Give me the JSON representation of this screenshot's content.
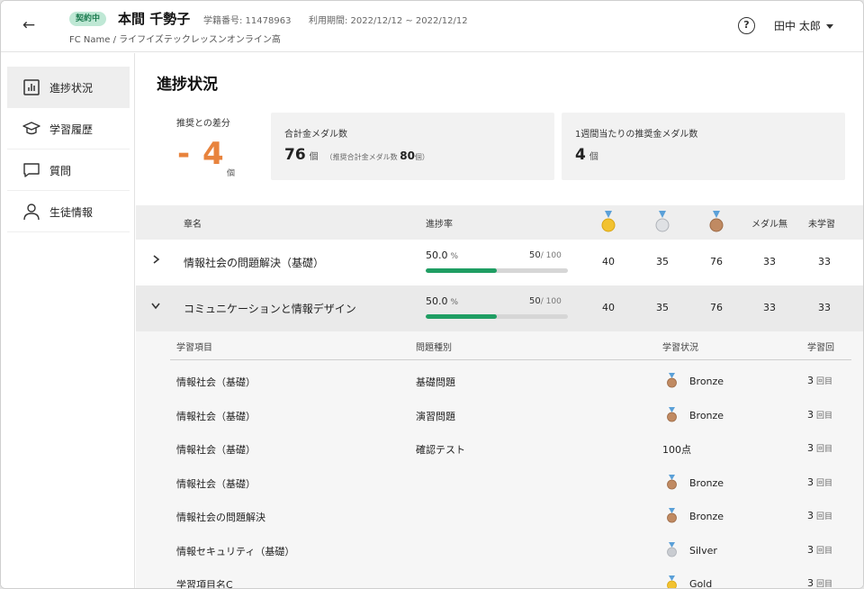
{
  "header": {
    "back_icon": "back-arrow-icon",
    "contract_badge": "契約中",
    "student_name": "本間 千勢子",
    "student_id": "学籍番号: 11478963",
    "period": "利用期間: 2022/12/12 ~ 2022/12/12",
    "breadcrumb": "FC Name / ライフイズテックレッスンオンライン高",
    "help_icon": "help-icon",
    "user_name": "田中 太郎"
  },
  "sidebar": {
    "items": [
      {
        "label": "進捗状況",
        "icon": "chart-icon",
        "active": true
      },
      {
        "label": "学習履歴",
        "icon": "graduation-cap-icon",
        "active": false
      },
      {
        "label": "質問",
        "icon": "chat-bubble-icon",
        "active": false
      },
      {
        "label": "生徒情報",
        "icon": "person-icon",
        "active": false
      }
    ]
  },
  "main": {
    "title": "進捗状況",
    "recommend_diff": {
      "label": "推奨との差分",
      "value": "- 4",
      "unit": "個"
    },
    "total_medals": {
      "label": "合計金メダル数",
      "value": "76",
      "unit": "個",
      "sub_label": "（推奨合計金メダル数",
      "sub_value": "80",
      "sub_unit": "個）"
    },
    "weekly_medals": {
      "label": "1週間当たりの推奨金メダル数",
      "value": "4",
      "unit": "個"
    }
  },
  "table": {
    "headers": {
      "chapter": "章名",
      "progress": "進捗率",
      "no_medal": "メダル無",
      "not_studied": "未学習"
    },
    "medal_colors": {
      "gold": "#f2c230",
      "silver": "#c9ccd1",
      "bronze": "#c08a62",
      "ribbon": "#5aa0d8"
    },
    "rows": [
      {
        "name": "情報社会の問題解決（基礎）",
        "percent": "50.0",
        "percent_unit": "%",
        "done": "50",
        "total": "/ 100",
        "progress": 0.5,
        "gold": "40",
        "silver": "35",
        "bronze": "76",
        "no_medal": "33",
        "not_studied": "33",
        "expanded": false
      },
      {
        "name": "コミュニケーションと情報デザイン",
        "percent": "50.0",
        "percent_unit": "%",
        "done": "50",
        "total": "/ 100",
        "progress": 0.5,
        "gold": "40",
        "silver": "35",
        "bronze": "76",
        "no_medal": "33",
        "not_studied": "33",
        "expanded": true
      }
    ]
  },
  "detail": {
    "headers": {
      "item": "学習項目",
      "type": "問題種別",
      "status": "学習状況",
      "count": "学習回"
    },
    "count_unit": "回目",
    "rows": [
      {
        "item": "情報社会（基礎）",
        "type": "基礎問題",
        "medal": "bronze",
        "status": "Bronze",
        "count": "3"
      },
      {
        "item": "情報社会（基礎）",
        "type": "演習問題",
        "medal": "bronze",
        "status": "Bronze",
        "count": "3"
      },
      {
        "item": "情報社会（基礎）",
        "type": "確認テスト",
        "medal": "",
        "status": "100点",
        "count": "3"
      },
      {
        "item": "情報社会（基礎）",
        "type": "",
        "medal": "bronze",
        "status": "Bronze",
        "count": "3"
      },
      {
        "item": "情報社会の問題解決",
        "type": "",
        "medal": "bronze",
        "status": "Bronze",
        "count": "3"
      },
      {
        "item": "情報セキュリティ（基礎）",
        "type": "",
        "medal": "silver",
        "status": "Silver",
        "count": "3"
      },
      {
        "item": "学習項目名C",
        "type": "",
        "medal": "gold",
        "status": "Gold",
        "count": "3"
      }
    ]
  }
}
